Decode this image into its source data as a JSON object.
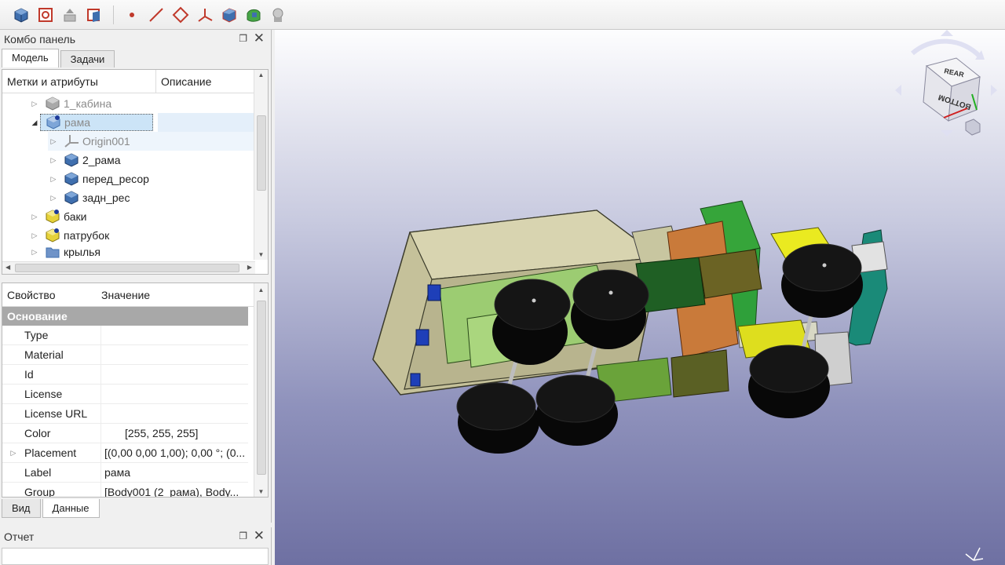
{
  "toolbar": {
    "icons": [
      "part-body-icon",
      "create-sketch-icon",
      "validate-sketch-icon",
      "map-sketch-icon",
      "datum-point-icon",
      "datum-line-icon",
      "datum-plane-icon",
      "local-coordinate-system-icon",
      "shape-binder-icon",
      "subshape-binder-icon",
      "clone-icon"
    ]
  },
  "combo": {
    "title": "Комбо панель",
    "tabs": [
      "Модель",
      "Задачи"
    ]
  },
  "tree": {
    "header_labels": "Метки и атрибуты",
    "header_description": "Описание",
    "items": [
      {
        "label": "1_кабина",
        "icon": "body-gray-icon",
        "level": 0,
        "state": "collapsed"
      },
      {
        "label": "рама",
        "icon": "body-active-icon",
        "level": 0,
        "state": "expanded"
      },
      {
        "label": "Origin001",
        "icon": "origin-icon",
        "level": 1,
        "state": "collapsed"
      },
      {
        "label": "2_рама",
        "icon": "body-icon",
        "level": 1,
        "state": "collapsed"
      },
      {
        "label": "перед_ресор",
        "icon": "body-icon",
        "level": 1,
        "state": "collapsed"
      },
      {
        "label": "задн_рес",
        "icon": "body-icon",
        "level": 1,
        "state": "collapsed"
      },
      {
        "label": "баки",
        "icon": "part-yellow-icon",
        "level": 0,
        "state": "collapsed"
      },
      {
        "label": "патрубок",
        "icon": "part-yellow-icon",
        "level": 0,
        "state": "collapsed"
      },
      {
        "label": "крылья",
        "icon": "folder-icon",
        "level": 0,
        "state": "collapsed"
      }
    ]
  },
  "properties": {
    "header_property": "Свойство",
    "header_value": "Значение",
    "group": "Основание",
    "rows": [
      {
        "name": "Type",
        "value": ""
      },
      {
        "name": "Material",
        "value": ""
      },
      {
        "name": "Id",
        "value": ""
      },
      {
        "name": "License",
        "value": ""
      },
      {
        "name": "License URL",
        "value": ""
      },
      {
        "name": "Color",
        "value": "[255, 255, 255]"
      },
      {
        "name": "Placement",
        "value": "[(0,00 0,00 1,00); 0,00 °; (0..."
      },
      {
        "name": "Label",
        "value": "рама"
      },
      {
        "name": "Group",
        "value": "[Body001 (2_рама), Body..."
      }
    ],
    "bottom_tabs": [
      "Вид",
      "Данные"
    ]
  },
  "report": {
    "title": "Отчет"
  },
  "navcube": {
    "face_top": "REAR",
    "face_front": "BOTTOM"
  },
  "colors": {
    "selection": "#cce4f7",
    "group_header": "#a8a8a8",
    "body_blue": "#3f6fae",
    "part_yellow": "#e6d23a",
    "wheel": "#0c0c0c",
    "cab": "#c5c19a"
  }
}
